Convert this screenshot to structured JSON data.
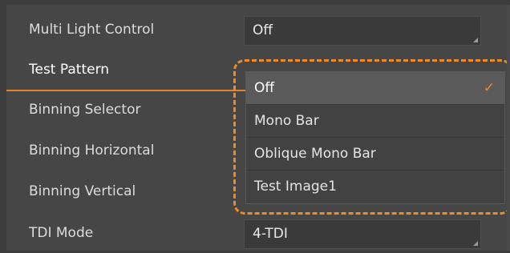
{
  "rows": [
    {
      "label": "Multi Light Control",
      "value": "Off"
    },
    {
      "label": "Test Pattern",
      "value": ""
    },
    {
      "label": "Binning Selector",
      "value": ""
    },
    {
      "label": "Binning Horizontal",
      "value": ""
    },
    {
      "label": "Binning Vertical",
      "value": ""
    },
    {
      "label": "TDI Mode",
      "value": "4-TDI"
    }
  ],
  "dropdown": {
    "options": [
      "Off",
      "Mono Bar",
      "Oblique Mono Bar",
      "Test Image1"
    ],
    "selected": "Off",
    "check_glyph": "✓"
  },
  "colors": {
    "accent": "#f08a24",
    "background": "#464646",
    "field": "#3a3a3a"
  }
}
